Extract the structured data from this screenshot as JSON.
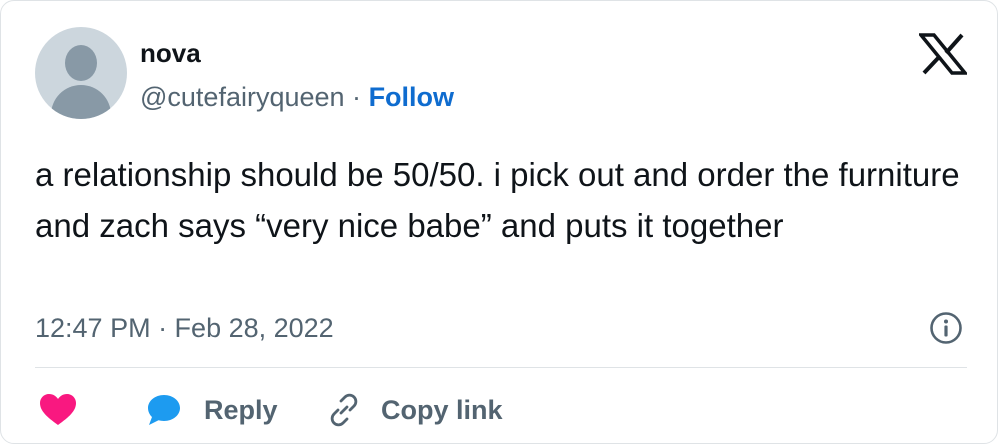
{
  "tweet": {
    "author_name": "nova",
    "handle": "@cutefairyqueen",
    "separator": "·",
    "follow_label": "Follow",
    "text": "a relationship should be 50/50. i pick out and order the furniture and zach says “very nice babe” and puts it together",
    "timestamp": "12:47 PM · Feb 28, 2022"
  },
  "actions": {
    "like_icon": "heart-icon",
    "reply_label": "Reply",
    "reply_icon": "speech-bubble-icon",
    "copy_label": "Copy link",
    "copy_icon": "link-icon"
  },
  "colors": {
    "follow": "#0f6ccf",
    "heart": "#f91880",
    "reply_bubble": "#1d9bf0",
    "secondary_text": "#536471",
    "border": "#dfe3e6"
  },
  "icons": {
    "logo": "x-logo-icon",
    "info": "info-icon",
    "avatar": "default-avatar-icon"
  }
}
